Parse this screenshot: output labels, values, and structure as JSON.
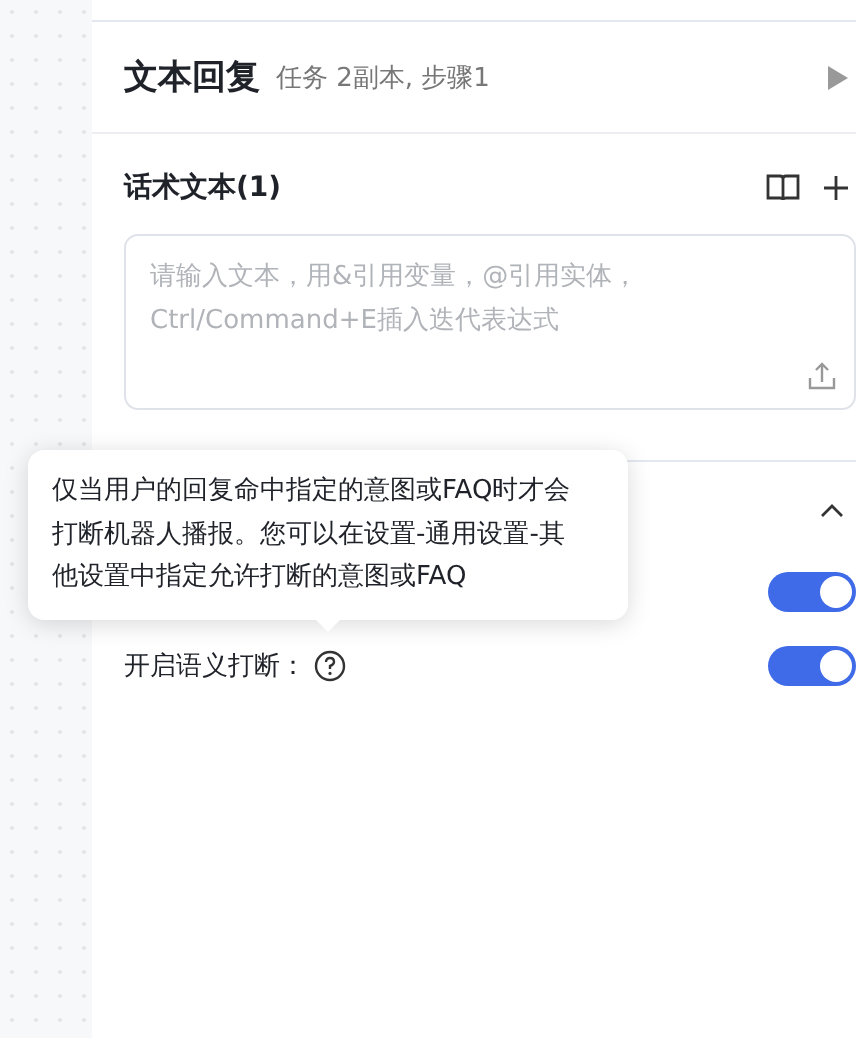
{
  "header": {
    "title": "文本回复",
    "subtitle": "任务 2副本, 步骤1"
  },
  "script_text": {
    "title": "话术文本(1)",
    "placeholder": "请输入文本，用&引用变量，@引用实体，Ctrl/Command+E插入迭代表达式"
  },
  "settings": {
    "expanded": true,
    "switches": [
      {
        "on": true
      },
      {
        "label": "开启语义打断：",
        "on": true
      }
    ]
  },
  "tooltip": {
    "text": "仅当用户的回复命中指定的意图或FAQ时才会打断机器人播报。您可以在设置-通用设置-其他设置中指定允许打断的意图或FAQ"
  }
}
